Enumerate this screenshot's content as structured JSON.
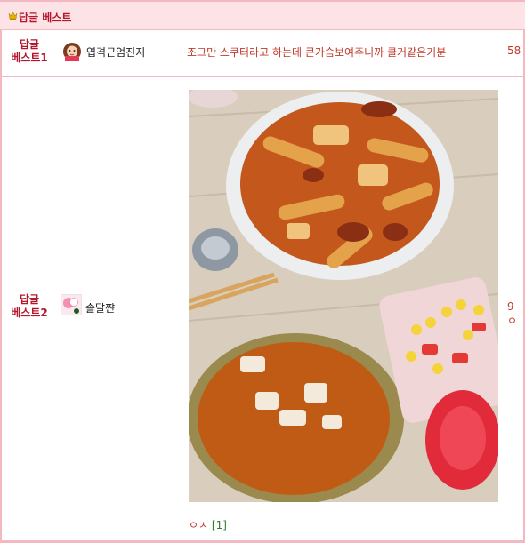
{
  "header": {
    "title": "답글 베스트",
    "icon": "crown-icon"
  },
  "rows": [
    {
      "rank_line1": "답글",
      "rank_line2": "베스트1",
      "nickname": "엽격근엄진지",
      "title": "조그만 스쿠터라고 하는데 큰가슴보여주니까 클거같은기분",
      "count": "58"
    },
    {
      "rank_line1": "답글",
      "rank_line2": "베스트2",
      "nickname": "솔달쨘",
      "title": "ㅇㅅ",
      "comment_count": "[1]",
      "count": "9 ㅇ"
    }
  ],
  "colors": {
    "accent": "#b4162b",
    "border": "#f4b8c0",
    "header_bg": "#fde3e6",
    "comment": "#2e7d32"
  }
}
